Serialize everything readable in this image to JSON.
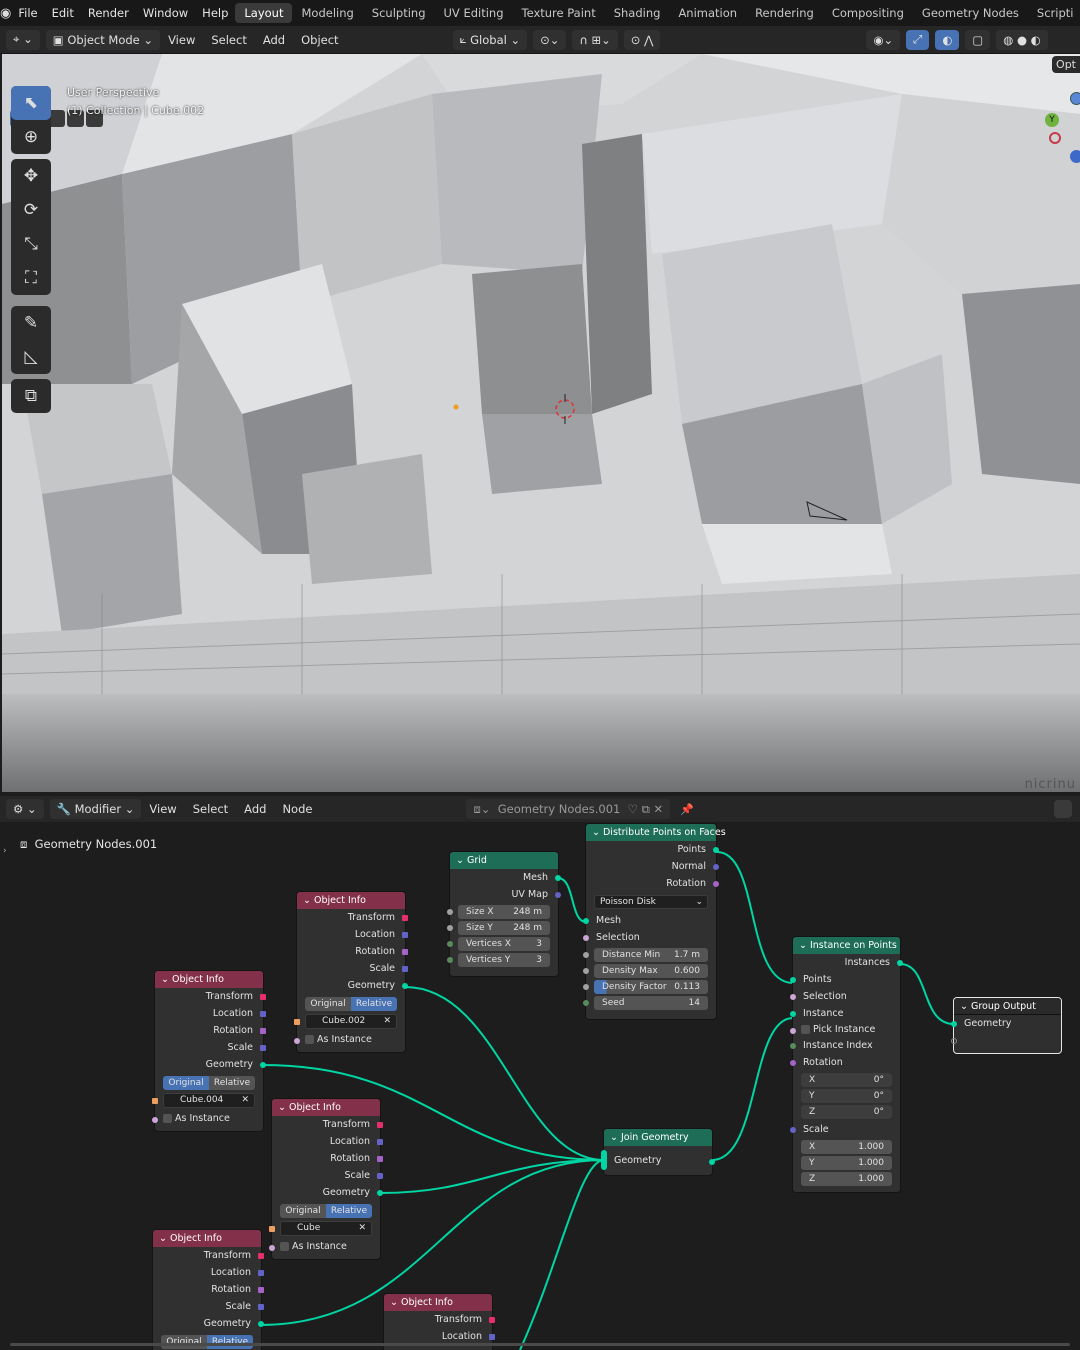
{
  "menubar": {
    "items": [
      "File",
      "Edit",
      "Render",
      "Window",
      "Help"
    ]
  },
  "workspaces": [
    "Layout",
    "Modeling",
    "Sculpting",
    "UV Editing",
    "Texture Paint",
    "Shading",
    "Animation",
    "Rendering",
    "Compositing",
    "Geometry Nodes",
    "Scripti"
  ],
  "active_workspace": "Layout",
  "viewport_header": {
    "mode": "Object Mode",
    "menus": [
      "View",
      "Select",
      "Add",
      "Object"
    ],
    "transform_orientation": "Global",
    "options_label": "Opt"
  },
  "viewport": {
    "perspective": "User Perspective",
    "collection": "(1) Collection | Cube.002",
    "watermark": "nicrinu",
    "gizmo_axis": "Y"
  },
  "node_header": {
    "editor_type": "Modifier",
    "menus": [
      "View",
      "Select",
      "Add",
      "Node"
    ],
    "node_group": "Geometry Nodes.001"
  },
  "breadcrumb": "Geometry Nodes.001",
  "nodes": {
    "grid": {
      "title": "Grid",
      "out_mesh": "Mesh",
      "out_uv": "UV Map",
      "size_x_label": "Size X",
      "size_x": "248 m",
      "size_y_label": "Size Y",
      "size_y": "248 m",
      "vx_label": "Vertices X",
      "vx": "3",
      "vy_label": "Vertices Y",
      "vy": "3"
    },
    "distribute": {
      "title": "Distribute Points on Faces",
      "out_points": "Points",
      "out_normal": "Normal",
      "out_rotation": "Rotation",
      "method": "Poisson Disk",
      "in_mesh": "Mesh",
      "in_selection": "Selection",
      "dmin_label": "Distance Min",
      "dmin": "1.7 m",
      "dmax_label": "Density Max",
      "dmax": "0.600",
      "dfac_label": "Density Factor",
      "dfac": "0.113",
      "seed_label": "Seed",
      "seed": "14"
    },
    "instance": {
      "title": "Instance on Points",
      "out_instances": "Instances",
      "in_points": "Points",
      "in_selection": "Selection",
      "in_instance": "Instance",
      "pick": "Pick Instance",
      "index": "Instance Index",
      "rotation": "Rotation",
      "rx_label": "X",
      "rx": "0°",
      "ry_label": "Y",
      "ry": "0°",
      "rz_label": "Z",
      "rz": "0°",
      "scale": "Scale",
      "sx_label": "X",
      "sx": "1.000",
      "sy_label": "Y",
      "sy": "1.000",
      "sz_label": "Z",
      "sz": "1.000"
    },
    "group_output": {
      "title": "Group Output",
      "in_geometry": "Geometry"
    },
    "join": {
      "title": "Join Geometry",
      "in_geometry": "Geometry"
    },
    "obj1": {
      "title": "Object Info",
      "outputs": [
        "Transform",
        "Location",
        "Rotation",
        "Scale",
        "Geometry"
      ],
      "mode_a": "Original",
      "mode_b": "Relative",
      "object": "Cube.002",
      "as_instance": "As Instance"
    },
    "obj2": {
      "title": "Object Info",
      "outputs": [
        "Transform",
        "Location",
        "Rotation",
        "Scale",
        "Geometry"
      ],
      "mode_a": "Original",
      "mode_b": "Relative",
      "object": "Cube.004",
      "as_instance": "As Instance"
    },
    "obj3": {
      "title": "Object Info",
      "outputs": [
        "Transform",
        "Location",
        "Rotation",
        "Scale",
        "Geometry"
      ],
      "mode_a": "Original",
      "mode_b": "Relative",
      "object": "Cube",
      "as_instance": "As Instance"
    },
    "obj4": {
      "title": "Object Info",
      "outputs": [
        "Transform",
        "Location",
        "Rotation",
        "Scale",
        "Geometry"
      ],
      "mode_a": "Original",
      "mode_b": "Relative"
    },
    "obj5": {
      "title": "Object Info",
      "outputs": [
        "Transform",
        "Location"
      ]
    }
  },
  "colors": {
    "accent": "#4772b3",
    "object_header": "#83314a",
    "geometry_header": "#1e6e57",
    "geometry_socket": "#00d6a3"
  }
}
